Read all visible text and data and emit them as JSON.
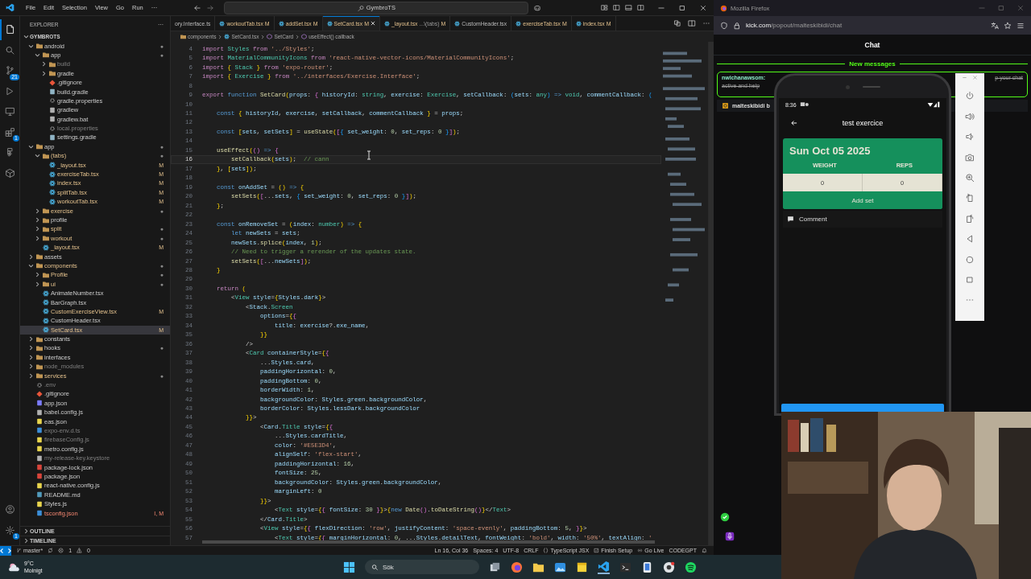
{
  "vscode": {
    "menu": [
      "File",
      "Edit",
      "Selection",
      "View",
      "Go",
      "Run",
      "···"
    ],
    "search": "GymbroTS",
    "activity": [
      {
        "kind": "explorer",
        "selected": true
      },
      {
        "kind": "search",
        "selected": false
      },
      {
        "kind": "scm",
        "selected": false,
        "badge": "21"
      },
      {
        "kind": "debug",
        "selected": false
      },
      {
        "kind": "remote",
        "selected": false
      },
      {
        "kind": "extensions",
        "selected": false,
        "badge": "1"
      },
      {
        "kind": "shapes",
        "selected": false
      },
      {
        "kind": "box",
        "selected": false
      }
    ],
    "activity_bottom": [
      {
        "kind": "account"
      },
      {
        "kind": "settings",
        "badge": "1"
      }
    ],
    "explorer": {
      "title": "EXPLORER",
      "more": "···",
      "root": "GYMBROTS",
      "sections": [
        "OUTLINE",
        "TIMELINE"
      ],
      "tree": [
        {
          "name": "android",
          "kind": "folder",
          "expanded": true,
          "modified": false,
          "ignored": false,
          "error": false,
          "badge": "●",
          "selected": false,
          "children": [
            {
              "name": "app",
              "kind": "folder",
              "expanded": true,
              "modified": false,
              "ignored": false,
              "error": false,
              "badge": "●",
              "selected": false,
              "children": [
                {
                  "name": "build",
                  "kind": "folder",
                  "expanded": false,
                  "modified": false,
                  "ignored": true,
                  "error": false,
                  "selected": false
                },
                {
                  "name": "gradle",
                  "kind": "folder",
                  "expanded": false,
                  "modified": false,
                  "ignored": false,
                  "error": false,
                  "selected": false
                },
                {
                  "name": ".gitignore",
                  "kind": "git",
                  "modified": false,
                  "ignored": false,
                  "error": false,
                  "selected": false
                },
                {
                  "name": "build.gradle",
                  "kind": "gradle",
                  "modified": false,
                  "ignored": false,
                  "error": false,
                  "selected": false
                },
                {
                  "name": "gradle.properties",
                  "kind": "gear",
                  "modified": false,
                  "ignored": false,
                  "error": false,
                  "selected": false
                },
                {
                  "name": "gradlew",
                  "kind": "file",
                  "modified": false,
                  "ignored": false,
                  "error": false,
                  "selected": false
                },
                {
                  "name": "gradlew.bat",
                  "kind": "file",
                  "modified": false,
                  "ignored": false,
                  "error": false,
                  "selected": false
                },
                {
                  "name": "local.properties",
                  "kind": "gear",
                  "modified": false,
                  "ignored": true,
                  "error": false,
                  "selected": false
                },
                {
                  "name": "settings.gradle",
                  "kind": "gradle",
                  "modified": false,
                  "ignored": false,
                  "error": false,
                  "selected": false
                }
              ]
            }
          ]
        },
        {
          "name": "app",
          "kind": "folder",
          "expanded": true,
          "modified": false,
          "ignored": false,
          "error": false,
          "badge": "●",
          "selected": false,
          "children": [
            {
              "name": "(tabs)",
              "kind": "folder",
              "expanded": true,
              "modified": true,
              "ignored": false,
              "error": false,
              "badge": "●",
              "selected": false,
              "children": [
                {
                  "name": "_layout.tsx",
                  "kind": "react",
                  "modified": true,
                  "ignored": false,
                  "error": false,
                  "badge": "M",
                  "selected": false
                },
                {
                  "name": "exerciseTab.tsx",
                  "kind": "react",
                  "modified": true,
                  "ignored": false,
                  "error": false,
                  "badge": "M",
                  "selected": false
                },
                {
                  "name": "index.tsx",
                  "kind": "react",
                  "modified": true,
                  "ignored": false,
                  "error": false,
                  "badge": "M",
                  "selected": false
                },
                {
                  "name": "splitTab.tsx",
                  "kind": "react",
                  "modified": true,
                  "ignored": false,
                  "error": false,
                  "badge": "M",
                  "selected": false
                },
                {
                  "name": "workoutTab.tsx",
                  "kind": "react",
                  "modified": true,
                  "ignored": false,
                  "error": false,
                  "badge": "M",
                  "selected": false
                }
              ]
            },
            {
              "name": "exercise",
              "kind": "folder",
              "expanded": false,
              "modified": true,
              "ignored": false,
              "error": false,
              "badge": "●",
              "selected": false
            },
            {
              "name": "profile",
              "kind": "folder",
              "expanded": false,
              "modified": false,
              "ignored": false,
              "error": false,
              "selected": false
            },
            {
              "name": "split",
              "kind": "folder",
              "expanded": false,
              "modified": true,
              "ignored": false,
              "error": false,
              "badge": "●",
              "selected": false
            },
            {
              "name": "workout",
              "kind": "folder",
              "expanded": false,
              "modified": true,
              "ignored": false,
              "error": false,
              "badge": "●",
              "selected": false
            },
            {
              "name": "_layout.tsx",
              "kind": "react",
              "modified": true,
              "ignored": false,
              "error": false,
              "badge": "M",
              "selected": false
            }
          ]
        },
        {
          "name": "assets",
          "kind": "folder",
          "expanded": false,
          "modified": false,
          "ignored": false,
          "error": false,
          "selected": false
        },
        {
          "name": "components",
          "kind": "folder",
          "expanded": true,
          "modified": true,
          "ignored": false,
          "error": false,
          "badge": "●",
          "selected": false,
          "children": [
            {
              "name": "Profile",
              "kind": "folder",
              "expanded": false,
              "modified": true,
              "ignored": false,
              "error": false,
              "badge": "●",
              "selected": false
            },
            {
              "name": "ui",
              "kind": "folder",
              "expanded": false,
              "modified": true,
              "ignored": false,
              "error": false,
              "badge": "●",
              "selected": false
            },
            {
              "name": "AnimateNumber.tsx",
              "kind": "react",
              "modified": false,
              "ignored": false,
              "error": false,
              "selected": false
            },
            {
              "name": "BarGraph.tsx",
              "kind": "react",
              "modified": false,
              "ignored": false,
              "error": false,
              "selected": false
            },
            {
              "name": "CustomExerciseView.tsx",
              "kind": "react",
              "modified": true,
              "ignored": false,
              "error": false,
              "badge": "M",
              "selected": false
            },
            {
              "name": "CustomHeader.tsx",
              "kind": "react",
              "modified": false,
              "ignored": false,
              "error": false,
              "selected": false
            },
            {
              "name": "SetCard.tsx",
              "kind": "react",
              "modified": true,
              "ignored": false,
              "error": false,
              "badge": "M",
              "selected": true
            }
          ]
        },
        {
          "name": "constants",
          "kind": "folder",
          "expanded": false,
          "modified": false,
          "ignored": false,
          "error": false,
          "selected": false
        },
        {
          "name": "hooks",
          "kind": "folder",
          "expanded": false,
          "modified": false,
          "ignored": false,
          "error": false,
          "badge": "●",
          "selected": false
        },
        {
          "name": "interfaces",
          "kind": "folder",
          "expanded": false,
          "modified": false,
          "ignored": false,
          "error": false,
          "selected": false
        },
        {
          "name": "node_modules",
          "kind": "folder",
          "expanded": false,
          "modified": false,
          "ignored": true,
          "error": false,
          "selected": false
        },
        {
          "name": "services",
          "kind": "folder",
          "expanded": false,
          "modified": true,
          "ignored": false,
          "error": false,
          "badge": "●",
          "selected": false
        },
        {
          "name": ".env",
          "kind": "gear",
          "modified": false,
          "ignored": true,
          "error": false,
          "selected": false
        },
        {
          "name": ".gitignore",
          "kind": "git",
          "modified": false,
          "ignored": false,
          "error": false,
          "selected": false
        },
        {
          "name": "app.json",
          "kind": "info",
          "modified": false,
          "ignored": false,
          "error": false,
          "selected": false
        },
        {
          "name": "babel.config.js",
          "kind": "file",
          "modified": false,
          "ignored": false,
          "error": false,
          "selected": false
        },
        {
          "name": "eas.json",
          "kind": "json",
          "modified": false,
          "ignored": false,
          "error": false,
          "selected": false
        },
        {
          "name": "expo-env.d.ts",
          "kind": "ts",
          "modified": false,
          "ignored": true,
          "error": false,
          "selected": false
        },
        {
          "name": "firebaseConfig.js",
          "kind": "js",
          "modified": false,
          "ignored": true,
          "error": false,
          "selected": false
        },
        {
          "name": "metro.config.js",
          "kind": "js",
          "modified": false,
          "ignored": false,
          "error": false,
          "selected": false
        },
        {
          "name": "my-release-key.keystore",
          "kind": "file",
          "modified": false,
          "ignored": true,
          "error": false,
          "selected": false
        },
        {
          "name": "package-lock.json",
          "kind": "npm",
          "modified": false,
          "ignored": false,
          "error": false,
          "selected": false
        },
        {
          "name": "package.json",
          "kind": "npm",
          "modified": false,
          "ignored": false,
          "error": false,
          "selected": false
        },
        {
          "name": "react-native.config.js",
          "kind": "js",
          "modified": false,
          "ignored": false,
          "error": false,
          "selected": false
        },
        {
          "name": "README.md",
          "kind": "md",
          "modified": false,
          "ignored": false,
          "error": false,
          "selected": false
        },
        {
          "name": "Styles.js",
          "kind": "js",
          "modified": false,
          "ignored": false,
          "error": false,
          "selected": false
        },
        {
          "name": "tsconfig.json",
          "kind": "ts",
          "modified": true,
          "ignored": false,
          "error": true,
          "badge": "I, M",
          "selected": false
        }
      ]
    },
    "tabs": [
      {
        "label": "ory.Interface.ts",
        "kind": "plain",
        "modified": false,
        "selected": false
      },
      {
        "label": "workoutTab.tsx",
        "kind": "react",
        "modified": true,
        "badge": "M",
        "selected": false
      },
      {
        "label": "addSet.tsx",
        "kind": "react",
        "modified": true,
        "badge": "M",
        "selected": false
      },
      {
        "label": "SetCard.tsx",
        "kind": "react",
        "modified": true,
        "badge": "M",
        "selected": true
      },
      {
        "label": "_layout.tsx",
        "description": "...\\(tabs)",
        "kind": "react",
        "modified": true,
        "badge": "M",
        "selected": false
      },
      {
        "label": "CustomHeader.tsx",
        "kind": "react",
        "modified": false,
        "selected": false
      },
      {
        "label": "exerciseTab.tsx",
        "kind": "react",
        "modified": true,
        "badge": "M",
        "selected": false
      },
      {
        "label": "index.tsx",
        "kind": "react",
        "modified": true,
        "badge": "M",
        "selected": false
      }
    ],
    "breadcrumb": [
      {
        "text": "components",
        "kind": "folder"
      },
      {
        "text": "SetCard.tsx",
        "kind": "react"
      },
      {
        "text": "SetCard",
        "kind": "symbol"
      },
      {
        "text": "useEffect() callback",
        "kind": "symbol"
      }
    ],
    "lines": [
      {
        "n": "4",
        "current": false,
        "text": "import Styles from '../Styles';"
      },
      {
        "n": "5",
        "current": false,
        "text": "import MaterialCommunityIcons from 'react-native-vector-icons/MaterialCommunityIcons';"
      },
      {
        "n": "6",
        "current": false,
        "text": "import { Stack } from 'expo-router';"
      },
      {
        "n": "7",
        "current": false,
        "text": "import { Exercise } from '../interfaces/Exercise.Interface';"
      },
      {
        "n": "8",
        "current": false
      },
      {
        "n": "9",
        "current": false,
        "text": "export function SetCard(props: { historyId: string, exercise: Exercise, setCallback: (sets: any) => void, commentCallback: ("
      },
      {
        "n": "10",
        "current": false
      },
      {
        "n": "11",
        "current": false,
        "text": "    const { historyId, exercise, setCallback, commentCallback } = props;"
      },
      {
        "n": "12",
        "current": false
      },
      {
        "n": "13",
        "current": false,
        "text": "    const [sets, setSets] = useState([{ set_weight: 0, set_reps: 0 }]);"
      },
      {
        "n": "14",
        "current": false
      },
      {
        "n": "15",
        "current": false,
        "text": "    useEffect(() => {"
      },
      {
        "n": "16",
        "current": true,
        "text": "        setCallback(sets);  // cann"
      },
      {
        "n": "17",
        "current": false,
        "text": "    }, [sets]);"
      },
      {
        "n": "18",
        "current": false
      },
      {
        "n": "19",
        "current": false,
        "text": "    const onAddSet = () => {"
      },
      {
        "n": "20",
        "current": false,
        "text": "        setSets([...sets, { set_weight: 0, set_reps: 0 }]);"
      },
      {
        "n": "21",
        "current": false,
        "text": "    };"
      },
      {
        "n": "22",
        "current": false
      },
      {
        "n": "23",
        "current": false,
        "text": "    const onRemoveSet = (index: number) => {"
      },
      {
        "n": "24",
        "current": false,
        "text": "        let newSets = sets;"
      },
      {
        "n": "25",
        "current": false,
        "text": "        newSets.splice(index, 1);"
      },
      {
        "n": "26",
        "current": false,
        "text": "        // Need to trigger a rerender of the updates state."
      },
      {
        "n": "27",
        "current": false,
        "text": "        setSets([...newSets]);"
      },
      {
        "n": "28",
        "current": false,
        "text": "    }"
      },
      {
        "n": "29",
        "current": false
      },
      {
        "n": "30",
        "current": false,
        "text": "    return ("
      },
      {
        "n": "31",
        "current": false,
        "text": "        <View style={Styles.dark}>"
      },
      {
        "n": "32",
        "current": false,
        "text": "            <Stack.Screen"
      },
      {
        "n": "33",
        "current": false,
        "text": "                options={{"
      },
      {
        "n": "34",
        "current": false,
        "text": "                    title: exercise?.exe_name,"
      },
      {
        "n": "35",
        "current": false,
        "text": "                }}"
      },
      {
        "n": "36",
        "current": false,
        "text": "            />"
      },
      {
        "n": "37",
        "current": false,
        "text": "            <Card containerStyle={{"
      },
      {
        "n": "38",
        "current": false,
        "text": "                ...Styles.card,"
      },
      {
        "n": "39",
        "current": false,
        "text": "                paddingHorizontal: 0,"
      },
      {
        "n": "40",
        "current": false,
        "text": "                paddingBottom: 0,"
      },
      {
        "n": "41",
        "current": false,
        "text": "                borderWidth: 1,"
      },
      {
        "n": "42",
        "current": false,
        "text": "                backgroundColor: Styles.green.backgroundColor,"
      },
      {
        "n": "43",
        "current": false,
        "text": "                borderColor: Styles.lessDark.backgroundColor"
      },
      {
        "n": "44",
        "current": false,
        "text": "            }}>"
      },
      {
        "n": "45",
        "current": false,
        "text": "                <Card.Title style={{"
      },
      {
        "n": "46",
        "current": false,
        "text": "                    ...Styles.cardTitle,"
      },
      {
        "n": "47",
        "current": false,
        "text": "                    color: '#E5E3D4',"
      },
      {
        "n": "48",
        "current": false,
        "text": "                    alignSelf: 'flex-start',"
      },
      {
        "n": "49",
        "current": false,
        "text": "                    paddingHorizontal: 16,"
      },
      {
        "n": "50",
        "current": false,
        "text": "                    fontSize: 25,"
      },
      {
        "n": "51",
        "current": false,
        "text": "                    backgroundColor: Styles.green.backgroundColor,"
      },
      {
        "n": "52",
        "current": false,
        "text": "                    marginLeft: 0"
      },
      {
        "n": "53",
        "current": false,
        "text": "                }}>"
      },
      {
        "n": "54",
        "current": false,
        "text": "                    <Text style={{ fontSize: 30 }}>{new Date().toDateString()}</Text>"
      },
      {
        "n": "55",
        "current": false,
        "text": "                </Card.Title>"
      },
      {
        "n": "56",
        "current": false,
        "text": "                <View style={{ flexDirection: 'row', justifyContent: 'space-evenly', paddingBottom: 5, }}>"
      },
      {
        "n": "57",
        "current": false,
        "text": "                    <Text style={{ marginHorizontal: 0, ...Styles.detailText, fontWeight: 'bold', width: '50%', textAlign: '"
      }
    ],
    "status_bar": {
      "branch": "master*",
      "errors": "1",
      "warnings": "0",
      "right": [
        {
          "text": "Ln 16, Col 36",
          "kind": "plain"
        },
        {
          "text": "Spaces: 4",
          "kind": "plain"
        },
        {
          "text": "UTF-8",
          "kind": "plain"
        },
        {
          "text": "CRLF",
          "kind": "plain"
        },
        {
          "text": "TypeScript JSX",
          "kind": "braces"
        },
        {
          "text": "Finish Setup",
          "kind": "setup"
        },
        {
          "text": "Go Live",
          "kind": "radio"
        },
        {
          "text": "CODEGPT",
          "kind": "plain"
        }
      ]
    }
  },
  "firefox": {
    "title": "Mozilla Firefox",
    "url_host": "kick.com",
    "url_path": "/popout/malteskibidi/chat",
    "chat_title": "Chat",
    "divider": "New messages",
    "message": {
      "user": "nwichanawsom:",
      "text": "active and help",
      "text_end": "p your chat",
      "deleted": true
    },
    "viewer": "malteskibidi b"
  },
  "phone": {
    "time": "8:36",
    "title": "test exercice",
    "date": "Sun Oct 05 2025",
    "columns": [
      "WEIGHT",
      "REPS"
    ],
    "values": [
      "0",
      "0"
    ],
    "button": "Add set",
    "comment": "Comment"
  },
  "taskbar": {
    "temperature": "9°C",
    "weather": "Molnigt",
    "search": {
      "placeholder": "Sök"
    }
  }
}
